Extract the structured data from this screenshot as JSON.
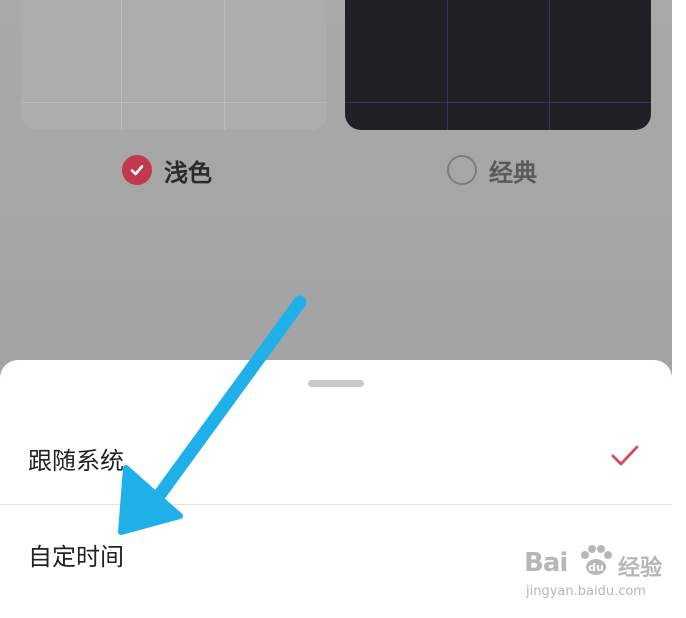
{
  "theme_options": [
    {
      "label": "浅色",
      "checked": true
    },
    {
      "label": "经典",
      "checked": false
    }
  ],
  "sheet": {
    "options": [
      {
        "label": "跟随系统",
        "selected": true
      },
      {
        "label": "自定时间",
        "selected": false
      }
    ]
  },
  "colors": {
    "accent": "#c1384f",
    "check": "#d9475f",
    "annotation_arrow": "#1fb0ea"
  },
  "watermark": {
    "brand_latin": "Bai",
    "brand_cn": "经验",
    "url": "jingyan.baidu.com"
  }
}
